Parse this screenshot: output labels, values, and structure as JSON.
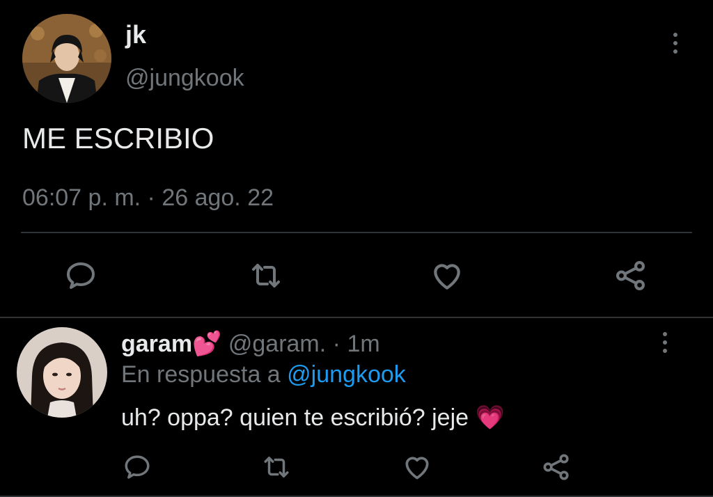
{
  "main_tweet": {
    "display_name": "jk",
    "handle": "@jungkook",
    "text": "ME ESCRIBIO",
    "timestamp": "06:07 p. m. · 26 ago. 22",
    "actions": [
      "reply-icon",
      "retweet-icon",
      "like-icon",
      "share-icon"
    ]
  },
  "reply": {
    "display_name": "garam",
    "name_emoji": "💕",
    "handle": "@garam.",
    "separator": "·",
    "time": "1m",
    "in_reply_prefix": "En respuesta a",
    "in_reply_handle": "@jungkook",
    "text": "uh? oppa? quien te escribió? jeje",
    "text_emoji": "💗",
    "actions": [
      "reply-icon",
      "retweet-icon",
      "like-icon",
      "share-icon"
    ]
  },
  "colors": {
    "background": "#000000",
    "primary_text": "#e7e9ea",
    "secondary_text": "#71767b",
    "link": "#1d9bf0",
    "divider": "#2f3336"
  }
}
